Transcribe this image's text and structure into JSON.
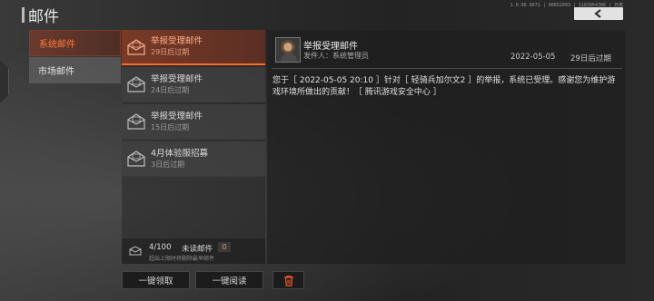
{
  "header": {
    "title": "邮件",
    "version": "1.0.90.9671 | 00652093 | 1183964386 | 日夜"
  },
  "categories": [
    {
      "label": "系统邮件",
      "active": true
    },
    {
      "label": "市场邮件",
      "active": false
    }
  ],
  "mails": [
    {
      "title": "举报受理邮件",
      "expire": "29日后过期",
      "active": true
    },
    {
      "title": "举报受理邮件",
      "expire": "24日后过期",
      "active": false
    },
    {
      "title": "举报受理邮件",
      "expire": "15日后过期",
      "active": false
    },
    {
      "title": "4月体验服招募",
      "expire": "3日后过期",
      "active": false
    }
  ],
  "mailbox": {
    "count": "4/100",
    "unread_label": "未读邮件",
    "unread_count": "0",
    "hint": "超出上限时将删除最早邮件"
  },
  "buttons": {
    "claim_all": "一键领取",
    "read_all": "一键阅读",
    "delete_icon": "trash-icon"
  },
  "detail": {
    "title": "举报受理邮件",
    "sender": "发件人：系统管理员",
    "date": "2022-05-05",
    "expire": "29日后过期",
    "body": "您于［ 2022-05-05 20:10 ］针对［ 轻骑兵加尔文2 ］的举报，系统已受理。感谢您为维护游戏环境所做出的贡献！［ 腾讯游戏安全中心 ］"
  },
  "colors": {
    "accent": "#ff6a2a",
    "accent_text": "#ff7a3c",
    "delete": "#ff5a2a"
  }
}
